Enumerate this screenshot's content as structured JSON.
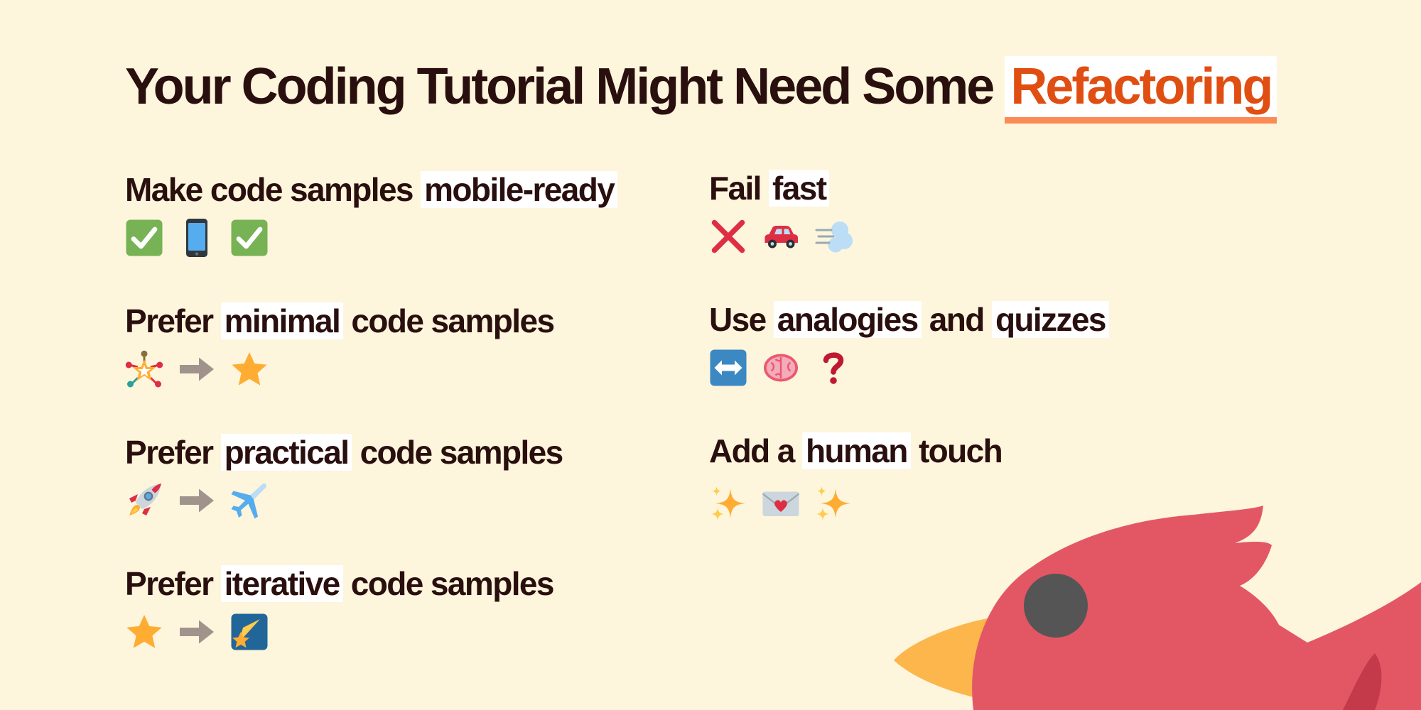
{
  "title": {
    "prefix": "Your Coding Tutorial Might Need Some",
    "accent": "Refactoring"
  },
  "tips": {
    "mobile": {
      "before": "Make code samples",
      "highlight": "mobile-ready",
      "after": ""
    },
    "minimal": {
      "before": "Prefer",
      "highlight": "minimal",
      "after": "code samples"
    },
    "practical": {
      "before": "Prefer",
      "highlight": "practical",
      "after": "code samples"
    },
    "iterative": {
      "before": "Prefer",
      "highlight": "iterative",
      "after": "code samples"
    },
    "failfast": {
      "before": "Fail",
      "highlight": "fast",
      "after": ""
    },
    "analogies": {
      "before": "Use",
      "highlight": "analogies",
      "mid": "and",
      "highlight2": "quizzes"
    },
    "human": {
      "before": "Add a",
      "highlight": "human",
      "after": "touch"
    }
  },
  "icons": {
    "mobile": [
      "check-mark-icon",
      "mobile-phone-icon",
      "check-mark-icon"
    ],
    "minimal": [
      "complex-star-icon",
      "right-arrow-icon",
      "star-icon"
    ],
    "practical": [
      "rocket-icon",
      "right-arrow-icon",
      "airplane-icon"
    ],
    "iterative": [
      "star-icon",
      "right-arrow-icon",
      "shooting-star-icon"
    ],
    "failfast": [
      "cross-mark-icon",
      "car-icon",
      "dash-icon"
    ],
    "analogies": [
      "left-right-arrow-icon",
      "brain-icon",
      "question-mark-icon"
    ],
    "human": [
      "sparkles-icon",
      "love-letter-icon",
      "sparkles-icon"
    ]
  },
  "colors": {
    "background": "#fdf5dc",
    "text": "#2a0f0f",
    "accent": "#e04e12",
    "accent_underline": "#fb8a55",
    "highlight": "#ffffff",
    "bird": "#e35765",
    "beak": "#fcb64b"
  }
}
